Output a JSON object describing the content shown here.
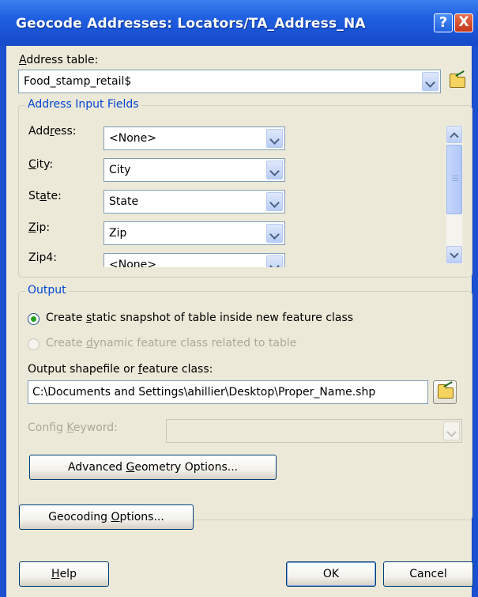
{
  "window": {
    "title": "Geocode Addresses:  Locators/TA_Address_NA",
    "help_button": "?",
    "close_button": "X"
  },
  "address_table": {
    "label_pre": "",
    "label_ul": "A",
    "label_post": "ddress table:",
    "value": "Food_stamp_retail$"
  },
  "input_fields": {
    "title": "Address Input Fields",
    "rows": [
      {
        "label_pre": "Add",
        "label_ul": "r",
        "label_post": "ess:",
        "value": "<None>"
      },
      {
        "label_pre": "",
        "label_ul": "C",
        "label_post": "ity:",
        "value": "City"
      },
      {
        "label_pre": "St",
        "label_ul": "a",
        "label_post": "te:",
        "value": "State"
      },
      {
        "label_pre": "",
        "label_ul": "Z",
        "label_post": "ip:",
        "value": "Zip"
      },
      {
        "label_pre": "Zip4:",
        "label_ul": "",
        "label_post": "",
        "value": "<None>"
      }
    ]
  },
  "output": {
    "title": "Output",
    "radio_static": {
      "pre": "Create ",
      "ul": "s",
      "post": "tatic snapshot of table inside new feature class",
      "checked": true
    },
    "radio_dynamic": {
      "pre": "Create ",
      "ul": "d",
      "post": "ynamic feature class related to table",
      "checked": false
    },
    "shapefile_label": {
      "pre": "Output shapefile or ",
      "ul": "f",
      "post": "eature class:"
    },
    "shapefile_value": "C:\\Documents and Settings\\ahillier\\Desktop\\Proper_Name.shp",
    "config_label": {
      "pre": "Config ",
      "ul": "K",
      "post": "eyword:"
    },
    "config_value": "",
    "advanced_button": {
      "pre": "Advanced ",
      "ul": "G",
      "post": "eometry Options..."
    }
  },
  "geocoding_button": {
    "pre": "Geocoding ",
    "ul": "O",
    "post": "ptions..."
  },
  "footer": {
    "help": {
      "pre": "",
      "ul": "H",
      "post": "elp"
    },
    "ok": "OK",
    "cancel": "Cancel"
  }
}
